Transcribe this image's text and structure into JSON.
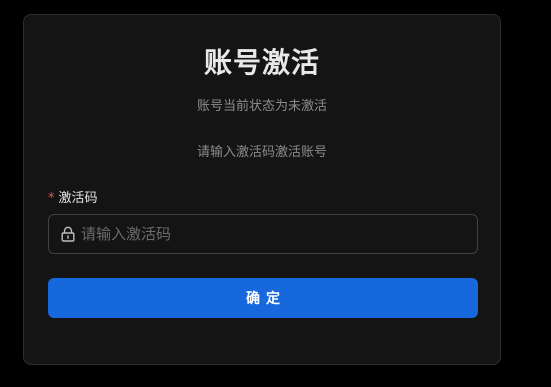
{
  "card": {
    "title": "账号激活",
    "status_text": "账号当前状态为未激活",
    "instruction_text": "请输入激活码激活账号"
  },
  "form": {
    "required_marker": "*",
    "field_label": "激活码",
    "input_placeholder": "请输入激活码",
    "input_value": "",
    "submit_label": "确定",
    "input_icon": "lock-icon"
  },
  "colors": {
    "background": "#000000",
    "card": "#141414",
    "primary_button": "#1668dc",
    "required": "#e0554b"
  }
}
